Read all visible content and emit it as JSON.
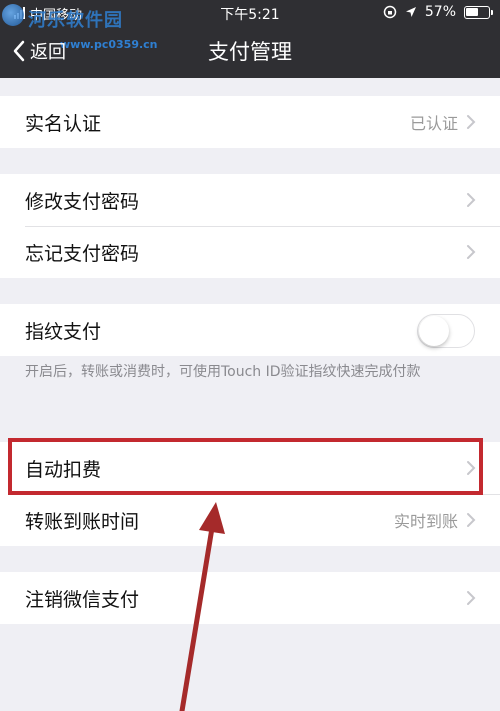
{
  "status_bar": {
    "carrier": "中国移动",
    "time": "下午5:21",
    "battery": "57%"
  },
  "watermark": {
    "text": "河乐软件园",
    "url": "www.pc0359.cn"
  },
  "nav": {
    "back_label": "返回",
    "title": "支付管理"
  },
  "sections": {
    "identity": {
      "label": "实名认证",
      "value": "已认证"
    },
    "change_password": {
      "label": "修改支付密码"
    },
    "forgot_password": {
      "label": "忘记支付密码"
    },
    "fingerprint": {
      "label": "指纹支付",
      "enabled": false,
      "note": "开启后，转账或消费时，可使用Touch ID验证指纹快速完成付款"
    },
    "auto_deduct": {
      "label": "自动扣费"
    },
    "transfer_time": {
      "label": "转账到账时间",
      "value": "实时到账"
    },
    "cancel_pay": {
      "label": "注销微信支付"
    }
  },
  "colors": {
    "header_bg": "#2f2f33",
    "page_bg": "#efeff4",
    "highlight": "#c3292f"
  }
}
